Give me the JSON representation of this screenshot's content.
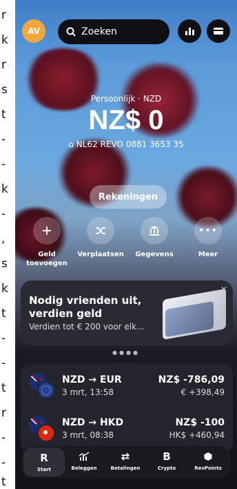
{
  "side_text": [
    "r",
    "k",
    "r",
    "s",
    "t",
    "-",
    "-",
    "k",
    "-",
    ",",
    "s",
    "k",
    "t",
    "-",
    "-",
    "t",
    "r",
    "-",
    "-",
    "t"
  ],
  "header": {
    "avatar_initials": "AV",
    "search_label": "Zoeken"
  },
  "account": {
    "label": "Persoonlijk · NZD",
    "balance": "NZ$ 0",
    "iban": "NL62 REVO 0881 3653 35"
  },
  "accounts_button": "Rekeningen",
  "actions": [
    {
      "label": "Geld\ntoevoegen",
      "icon": "plus-icon"
    },
    {
      "label": "Verplaatsen",
      "icon": "shuffle-icon"
    },
    {
      "label": "Gegevens",
      "icon": "bank-icon"
    },
    {
      "label": "Meer",
      "icon": "more-icon"
    }
  ],
  "promo": {
    "title": "Nodig vrienden uit, verdien geld",
    "subtitle": "Verdien tot € 200 voor elk..."
  },
  "transactions": [
    {
      "title": "NZD → EUR",
      "time": "3 mrt, 13:58",
      "amount": "NZ$ -786,09",
      "secondary": "€ +398,49"
    },
    {
      "title": "NZD → HKD",
      "time": "3 mrt, 08:38",
      "amount": "NZ$ -100",
      "secondary": "HK$ +460,94"
    }
  ],
  "tabs": [
    {
      "label": "Start",
      "icon": "revolut-icon"
    },
    {
      "label": "Beleggen",
      "icon": "chart-icon"
    },
    {
      "label": "Betalingen",
      "icon": "transfer-icon"
    },
    {
      "label": "Crypto",
      "icon": "bitcoin-icon"
    },
    {
      "label": "RevPoints",
      "icon": "points-icon"
    }
  ]
}
